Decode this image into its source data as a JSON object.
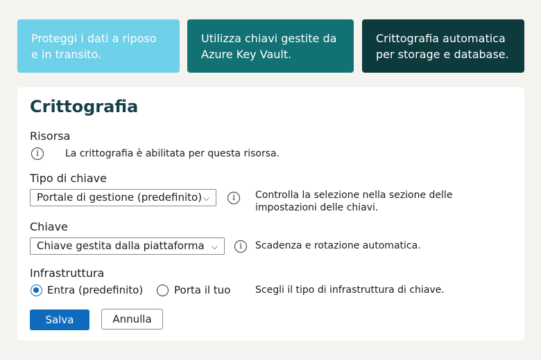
{
  "cards": [
    {
      "line1": "Proteggi i dati a riposo",
      "line2": "e in transito."
    },
    {
      "line1": "Utilizza chiavi gestite da",
      "line2": "Azure Key Vault."
    },
    {
      "line1": "Crittografia automatica",
      "line2": "per storage e database."
    }
  ],
  "panel": {
    "title": "Crittografia",
    "resource": {
      "label": "Risorsa",
      "info_text": "La crittografia è abilitata per questa risorsa."
    },
    "key_type": {
      "label": "Tipo di chiave",
      "selected": "Portale di gestione (predefinito)",
      "help_line1": "Controlla la selezione nella sezione delle",
      "help_line2": "impostazioni delle chiavi."
    },
    "key": {
      "label": "Chiave",
      "selected": "Chiave gestita dalla piattaforma",
      "help": "Scadenza e rotazione automatica."
    },
    "infrastructure": {
      "label": "Infrastruttura",
      "options": [
        {
          "label": "Entra (predefinito)",
          "checked": true
        },
        {
          "label": "Porta il tuo",
          "checked": false
        }
      ],
      "help": "Scegli il tipo di infrastruttura di chiave."
    },
    "buttons": {
      "save": "Salva",
      "cancel": "Annulla"
    }
  },
  "colors": {
    "card1": "#6fd0ea",
    "card2": "#127173",
    "card3": "#0d3a3d",
    "title": "#17414a",
    "primary": "#0f6cbd"
  },
  "icons": [
    "info-icon",
    "chevron-down-icon",
    "radio-icon"
  ]
}
